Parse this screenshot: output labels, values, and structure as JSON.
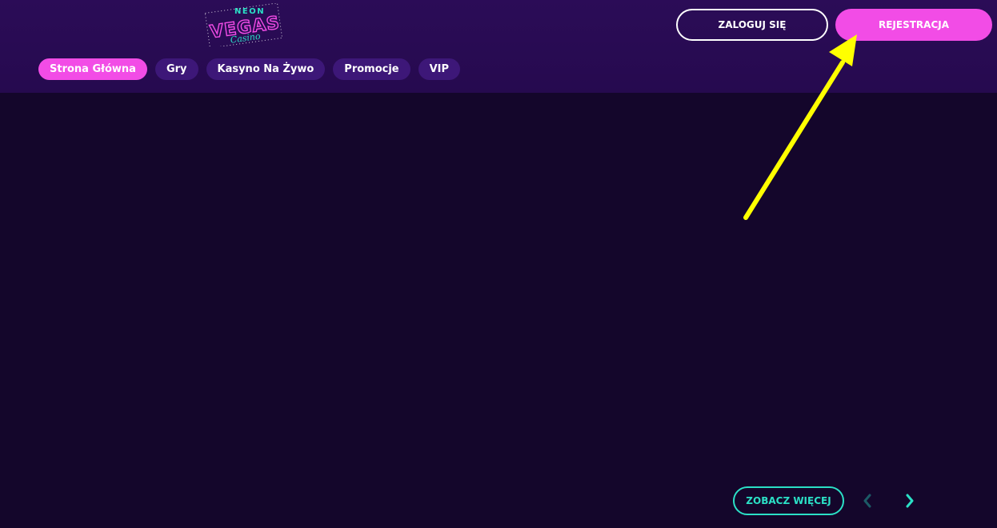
{
  "header": {
    "logo": {
      "top_text": "NEON",
      "main_text": "VEGAS",
      "sub_text": "Casino"
    },
    "login_label": "ZALOGUJ SIĘ",
    "register_label": "REJESTRACJA"
  },
  "nav": {
    "items": [
      {
        "label": "Strona Główna",
        "active": true
      },
      {
        "label": "Gry",
        "active": false
      },
      {
        "label": "Kasyno Na Żywo",
        "active": false
      },
      {
        "label": "Promocje",
        "active": false
      },
      {
        "label": "VIP",
        "active": false
      }
    ]
  },
  "carousel": {
    "see_more_label": "ZOBACZ WIĘCEJ",
    "prev_icon": "chevron-left-icon",
    "next_icon": "chevron-right-icon"
  },
  "annotation": {
    "icon": "arrow-icon",
    "color": "#ffff00"
  },
  "colors": {
    "header_bg": "#2b0c57",
    "page_bg": "#14062b",
    "accent_pink": "#f24ce6",
    "accent_teal": "#2be0c6",
    "nav_pill": "#3d1778"
  }
}
